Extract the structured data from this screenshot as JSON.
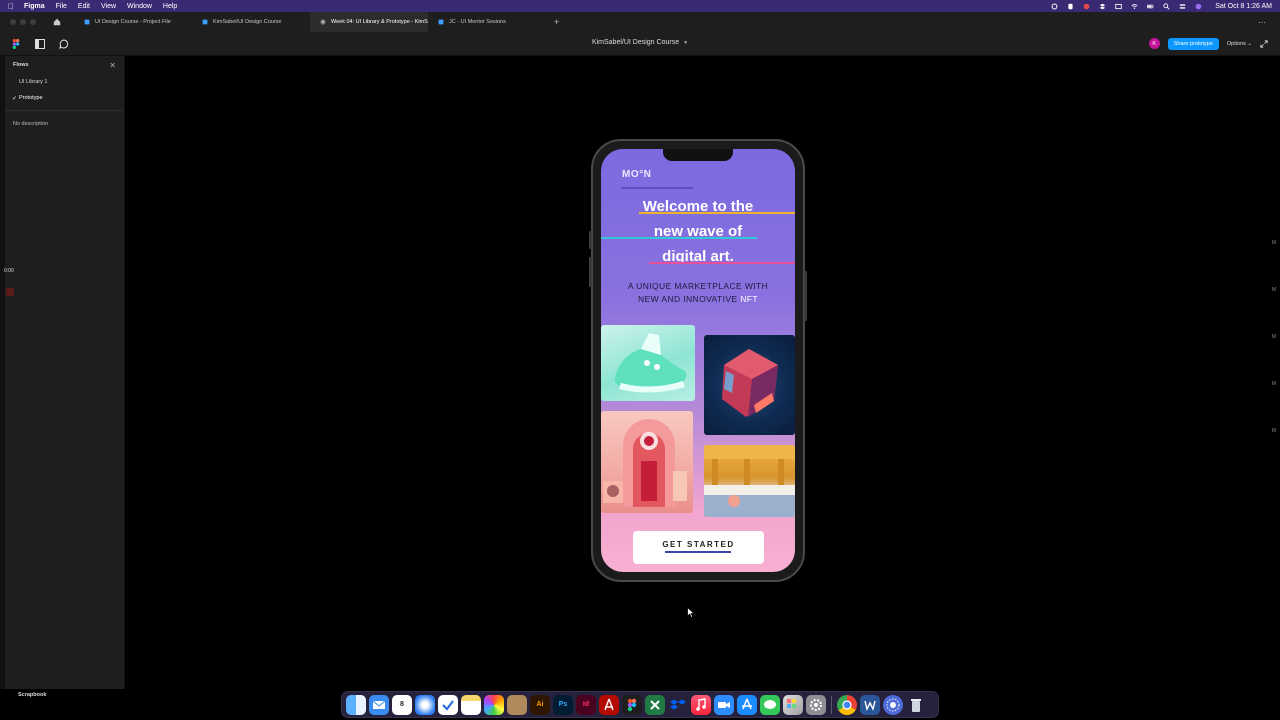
{
  "menubar": {
    "app_name": "Figma",
    "items": [
      "File",
      "Edit",
      "View",
      "Window",
      "Help"
    ],
    "clock": "Sat Oct 8  1:26 AM"
  },
  "tabs": [
    {
      "label": "UI Design Course - Project File",
      "active": false
    },
    {
      "label": "KimSabel/UI Design Course",
      "active": false
    },
    {
      "label": "Week 04: UI Library & Prototype - KimS",
      "active": true
    },
    {
      "label": "JC - UI Mentor Sesions",
      "active": false
    }
  ],
  "toolbar": {
    "file_title": "KimSabel/UI Design Course",
    "avatar_initial": "K",
    "share_label": "Share prototype",
    "options_label": "Options"
  },
  "flows_panel": {
    "title": "Flows",
    "items": [
      {
        "label": "UI Library 1",
        "selected": false
      },
      {
        "label": "Prototype",
        "selected": true
      }
    ],
    "description": "No description"
  },
  "timer": "0:00",
  "right_marks": [
    "M",
    "M",
    "M",
    "M",
    "M"
  ],
  "scrapbook_label": "Scrapbook",
  "prototype_screen": {
    "brand": "MO°N",
    "headline_lines": [
      "Welcome to the",
      "new wave of",
      "digital art."
    ],
    "subhead_line1": "A UNIQUE MARKETPLACE WITH",
    "subhead_line2_prefix": "NEW AND INNOVATIVE ",
    "subhead_highlight": "NFT",
    "cta_label": "GET STARTED",
    "colors": {
      "accent_yellow": "#e8b62c",
      "accent_cyan": "#33c7d6",
      "accent_pink": "#e8509a",
      "cta_underline": "#3949ab"
    }
  },
  "dock_apps": [
    "finder",
    "mail",
    "calendar",
    "safari",
    "tasks",
    "notes",
    "photos",
    "archive",
    "Ai",
    "Ps",
    "Id",
    "acrobat",
    "figma",
    "excel",
    "dropbox",
    "music",
    "zoom",
    "app-store",
    "messages",
    "launchpad",
    "settings",
    "chrome",
    "word",
    "bloom",
    "trash"
  ],
  "dock_calendar_day": "8"
}
